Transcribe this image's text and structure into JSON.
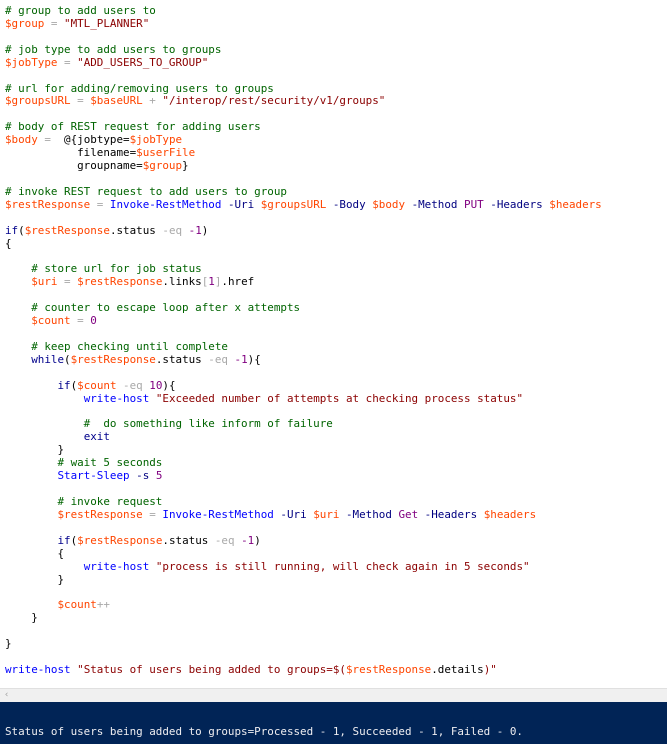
{
  "editor": {
    "lines": [
      [
        {
          "t": "# group to add users to",
          "k": "c"
        }
      ],
      [
        {
          "t": "$group",
          "k": "v"
        },
        {
          "t": " = ",
          "k": "o"
        },
        {
          "t": "\"MTL_PLANNER\"",
          "k": "s"
        }
      ],
      [],
      [
        {
          "t": "# job type to add users to groups",
          "k": "c"
        }
      ],
      [
        {
          "t": "$jobType",
          "k": "v"
        },
        {
          "t": " = ",
          "k": "o"
        },
        {
          "t": "\"ADD_USERS_TO_GROUP\"",
          "k": "s"
        }
      ],
      [],
      [
        {
          "t": "# url for adding/removing users to groups",
          "k": "c"
        }
      ],
      [
        {
          "t": "$groupsURL",
          "k": "v"
        },
        {
          "t": " = ",
          "k": "o"
        },
        {
          "t": "$baseURL",
          "k": "v"
        },
        {
          "t": " + ",
          "k": "o"
        },
        {
          "t": "\"/interop/rest/security/v1/groups\"",
          "k": "s"
        }
      ],
      [],
      [
        {
          "t": "# body of REST request for adding users",
          "k": "c"
        }
      ],
      [
        {
          "t": "$body",
          "k": "v"
        },
        {
          "t": " =  ",
          "k": "o"
        },
        {
          "t": "@{jobtype=",
          "k": "x"
        },
        {
          "t": "$jobType",
          "k": "v"
        }
      ],
      [
        {
          "t": "           filename=",
          "k": "x"
        },
        {
          "t": "$userFile",
          "k": "v"
        }
      ],
      [
        {
          "t": "           groupname=",
          "k": "x"
        },
        {
          "t": "$group",
          "k": "v"
        },
        {
          "t": "}",
          "k": "x"
        }
      ],
      [],
      [
        {
          "t": "# invoke REST request to add users to group",
          "k": "c"
        }
      ],
      [
        {
          "t": "$restResponse",
          "k": "v"
        },
        {
          "t": " = ",
          "k": "o"
        },
        {
          "t": "Invoke-RestMethod",
          "k": "m"
        },
        {
          "t": " -Uri ",
          "k": "p"
        },
        {
          "t": "$groupsURL",
          "k": "v"
        },
        {
          "t": " -Body ",
          "k": "p"
        },
        {
          "t": "$body",
          "k": "v"
        },
        {
          "t": " -Method ",
          "k": "p"
        },
        {
          "t": "PUT",
          "k": "n"
        },
        {
          "t": " -Headers ",
          "k": "p"
        },
        {
          "t": "$headers",
          "k": "v"
        }
      ],
      [],
      [
        {
          "t": "if",
          "k": "k"
        },
        {
          "t": "(",
          "k": "x"
        },
        {
          "t": "$restResponse",
          "k": "v"
        },
        {
          "t": ".status",
          "k": "x"
        },
        {
          "t": " -eq ",
          "k": "o"
        },
        {
          "t": "-1",
          "k": "n"
        },
        {
          "t": ")",
          "k": "x"
        }
      ],
      [
        {
          "t": "{",
          "k": "x"
        }
      ],
      [],
      [
        {
          "t": "    # store url for job status",
          "k": "c"
        }
      ],
      [
        {
          "t": "    ",
          "k": "x"
        },
        {
          "t": "$uri",
          "k": "v"
        },
        {
          "t": " = ",
          "k": "o"
        },
        {
          "t": "$restResponse",
          "k": "v"
        },
        {
          "t": ".links",
          "k": "x"
        },
        {
          "t": "[",
          "k": "o"
        },
        {
          "t": "1",
          "k": "n"
        },
        {
          "t": "]",
          "k": "o"
        },
        {
          "t": ".href",
          "k": "x"
        }
      ],
      [],
      [
        {
          "t": "    # counter to escape loop after x attempts",
          "k": "c"
        }
      ],
      [
        {
          "t": "    ",
          "k": "x"
        },
        {
          "t": "$count",
          "k": "v"
        },
        {
          "t": " = ",
          "k": "o"
        },
        {
          "t": "0",
          "k": "n"
        }
      ],
      [],
      [
        {
          "t": "    # keep checking until complete",
          "k": "c"
        }
      ],
      [
        {
          "t": "    ",
          "k": "x"
        },
        {
          "t": "while",
          "k": "k"
        },
        {
          "t": "(",
          "k": "x"
        },
        {
          "t": "$restResponse",
          "k": "v"
        },
        {
          "t": ".status",
          "k": "x"
        },
        {
          "t": " -eq ",
          "k": "o"
        },
        {
          "t": "-1",
          "k": "n"
        },
        {
          "t": "){",
          "k": "x"
        }
      ],
      [],
      [
        {
          "t": "        ",
          "k": "x"
        },
        {
          "t": "if",
          "k": "k"
        },
        {
          "t": "(",
          "k": "x"
        },
        {
          "t": "$count",
          "k": "v"
        },
        {
          "t": " -eq ",
          "k": "o"
        },
        {
          "t": "10",
          "k": "n"
        },
        {
          "t": "){",
          "k": "x"
        }
      ],
      [
        {
          "t": "            ",
          "k": "x"
        },
        {
          "t": "write-host",
          "k": "m"
        },
        {
          "t": " ",
          "k": "x"
        },
        {
          "t": "\"Exceeded number of attempts at checking process status\"",
          "k": "s"
        }
      ],
      [],
      [
        {
          "t": "            #  do something like inform of failure",
          "k": "c"
        }
      ],
      [
        {
          "t": "            ",
          "k": "x"
        },
        {
          "t": "exit",
          "k": "k"
        }
      ],
      [
        {
          "t": "        }",
          "k": "x"
        }
      ],
      [
        {
          "t": "        # wait 5 seconds",
          "k": "c"
        }
      ],
      [
        {
          "t": "        ",
          "k": "x"
        },
        {
          "t": "Start-Sleep",
          "k": "m"
        },
        {
          "t": " -s ",
          "k": "p"
        },
        {
          "t": "5",
          "k": "n"
        }
      ],
      [],
      [
        {
          "t": "        # invoke request",
          "k": "c"
        }
      ],
      [
        {
          "t": "        ",
          "k": "x"
        },
        {
          "t": "$restResponse",
          "k": "v"
        },
        {
          "t": " = ",
          "k": "o"
        },
        {
          "t": "Invoke-RestMethod",
          "k": "m"
        },
        {
          "t": " -Uri ",
          "k": "p"
        },
        {
          "t": "$uri",
          "k": "v"
        },
        {
          "t": " -Method ",
          "k": "p"
        },
        {
          "t": "Get",
          "k": "n"
        },
        {
          "t": " -Headers ",
          "k": "p"
        },
        {
          "t": "$headers",
          "k": "v"
        }
      ],
      [],
      [
        {
          "t": "        ",
          "k": "x"
        },
        {
          "t": "if",
          "k": "k"
        },
        {
          "t": "(",
          "k": "x"
        },
        {
          "t": "$restResponse",
          "k": "v"
        },
        {
          "t": ".status",
          "k": "x"
        },
        {
          "t": " -eq ",
          "k": "o"
        },
        {
          "t": "-1",
          "k": "n"
        },
        {
          "t": ")",
          "k": "x"
        }
      ],
      [
        {
          "t": "        {",
          "k": "x"
        }
      ],
      [
        {
          "t": "            ",
          "k": "x"
        },
        {
          "t": "write-host",
          "k": "m"
        },
        {
          "t": " ",
          "k": "x"
        },
        {
          "t": "\"process is still running, will check again in 5 seconds\"",
          "k": "s"
        }
      ],
      [
        {
          "t": "        }",
          "k": "x"
        }
      ],
      [],
      [
        {
          "t": "        ",
          "k": "x"
        },
        {
          "t": "$count",
          "k": "v"
        },
        {
          "t": "++",
          "k": "o"
        }
      ],
      [
        {
          "t": "    }",
          "k": "x"
        }
      ],
      [],
      [
        {
          "t": "}",
          "k": "x"
        }
      ],
      [],
      [
        {
          "t": "write-host",
          "k": "m"
        },
        {
          "t": " ",
          "k": "x"
        },
        {
          "t": "\"Status of users being added to groups=$(",
          "k": "s"
        },
        {
          "t": "$restResponse",
          "k": "v"
        },
        {
          "t": ".details",
          "k": "x"
        },
        {
          "t": ")\"",
          "k": "s"
        }
      ]
    ]
  },
  "scrollbar": {
    "left_arrow": "‹"
  },
  "console": {
    "output": "Status of users being added to groups=Processed - 1, Succeeded - 1, Failed - 0."
  },
  "colors": {
    "comment": "#006400",
    "variable": "#ff4500",
    "string": "#8b0000",
    "command": "#0000ff",
    "parameter": "#000080",
    "operator": "#a9a9a9",
    "number": "#800080",
    "keyword": "#00008b",
    "console_background": "#012456",
    "console_text": "#eeedf0"
  }
}
